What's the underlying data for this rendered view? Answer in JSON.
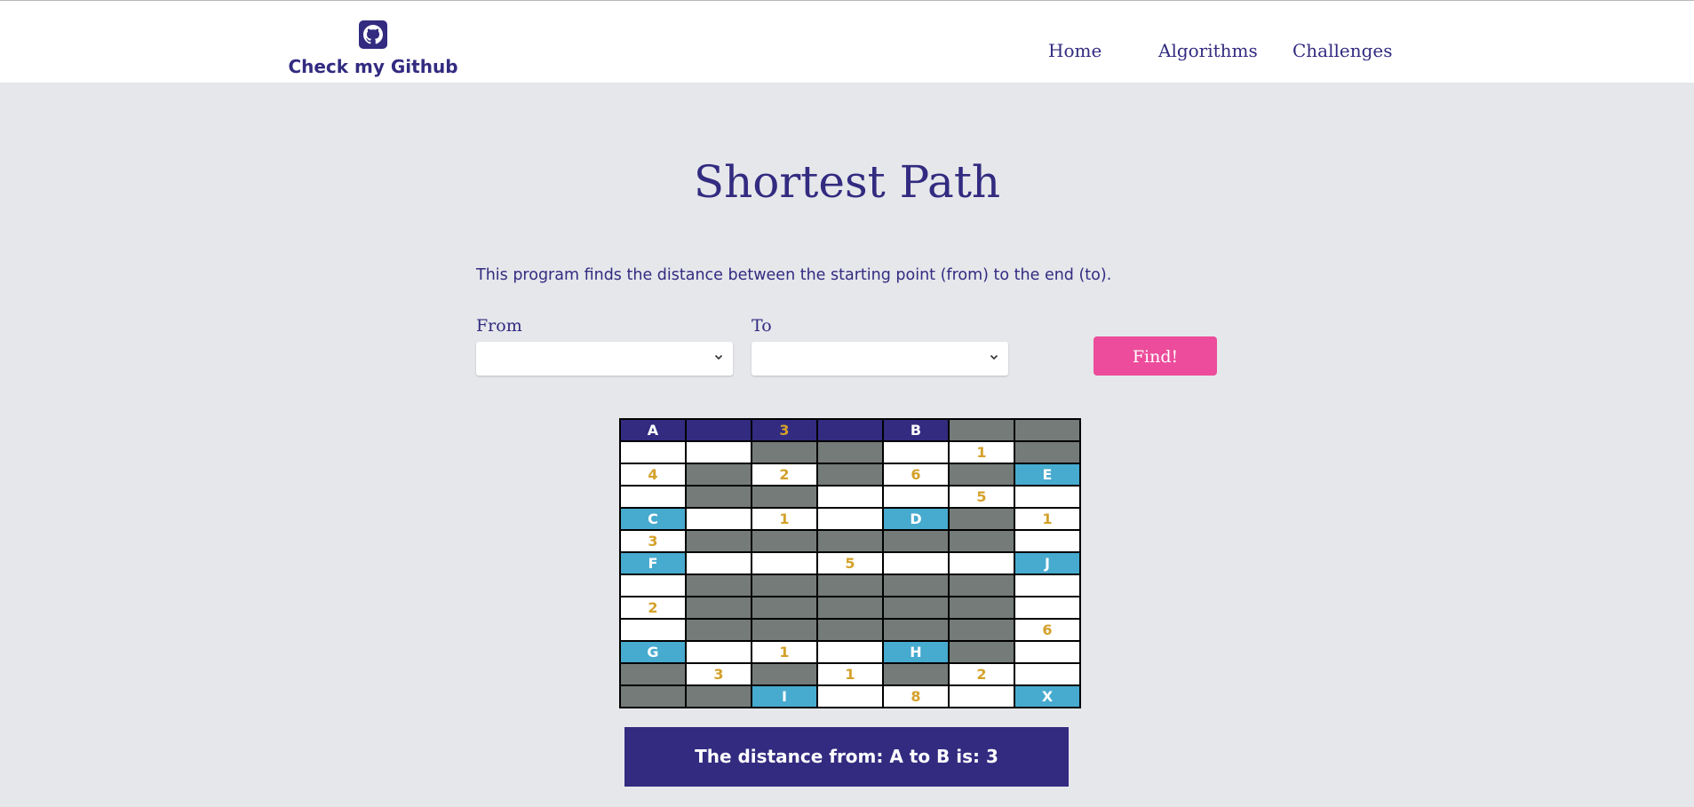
{
  "header": {
    "logo_text": "Check my Github",
    "nav": [
      "Home",
      "Algorithms",
      "Challenges"
    ]
  },
  "page": {
    "title": "Shortest Path",
    "description": "This program finds the distance between the starting point (from) to the end (to)."
  },
  "form": {
    "from_label": "From",
    "from_value": "",
    "to_label": "To",
    "to_value": "",
    "find_label": "Find!"
  },
  "grid": {
    "rows": [
      [
        [
          "s",
          "A"
        ],
        [
          "s",
          ""
        ],
        [
          "s",
          "3"
        ],
        [
          "s",
          ""
        ],
        [
          "s",
          "B"
        ],
        [
          "g",
          ""
        ],
        [
          "g",
          ""
        ]
      ],
      [
        [
          "w",
          ""
        ],
        [
          "w",
          ""
        ],
        [
          "g",
          ""
        ],
        [
          "g",
          ""
        ],
        [
          "w",
          ""
        ],
        [
          "w",
          "1"
        ],
        [
          "g",
          ""
        ]
      ],
      [
        [
          "w",
          "4"
        ],
        [
          "g",
          ""
        ],
        [
          "w",
          "2"
        ],
        [
          "g",
          ""
        ],
        [
          "w",
          "6"
        ],
        [
          "g",
          ""
        ],
        [
          "n",
          "E"
        ]
      ],
      [
        [
          "w",
          ""
        ],
        [
          "g",
          ""
        ],
        [
          "g",
          ""
        ],
        [
          "w",
          ""
        ],
        [
          "w",
          ""
        ],
        [
          "w",
          "5"
        ],
        [
          "w",
          ""
        ]
      ],
      [
        [
          "n",
          "C"
        ],
        [
          "w",
          ""
        ],
        [
          "w",
          "1"
        ],
        [
          "w",
          ""
        ],
        [
          "n",
          "D"
        ],
        [
          "g",
          ""
        ],
        [
          "w",
          "1"
        ]
      ],
      [
        [
          "w",
          "3"
        ],
        [
          "g",
          ""
        ],
        [
          "g",
          ""
        ],
        [
          "g",
          ""
        ],
        [
          "g",
          ""
        ],
        [
          "g",
          ""
        ],
        [
          "w",
          ""
        ]
      ],
      [
        [
          "n",
          "F"
        ],
        [
          "w",
          ""
        ],
        [
          "w",
          ""
        ],
        [
          "w",
          "5"
        ],
        [
          "w",
          ""
        ],
        [
          "w",
          ""
        ],
        [
          "n",
          "J"
        ]
      ],
      [
        [
          "w",
          ""
        ],
        [
          "g",
          ""
        ],
        [
          "g",
          ""
        ],
        [
          "g",
          ""
        ],
        [
          "g",
          ""
        ],
        [
          "g",
          ""
        ],
        [
          "w",
          ""
        ]
      ],
      [
        [
          "w",
          "2"
        ],
        [
          "g",
          ""
        ],
        [
          "g",
          ""
        ],
        [
          "g",
          ""
        ],
        [
          "g",
          ""
        ],
        [
          "g",
          ""
        ],
        [
          "w",
          ""
        ]
      ],
      [
        [
          "w",
          ""
        ],
        [
          "g",
          ""
        ],
        [
          "g",
          ""
        ],
        [
          "g",
          ""
        ],
        [
          "g",
          ""
        ],
        [
          "g",
          ""
        ],
        [
          "w",
          "6"
        ]
      ],
      [
        [
          "n",
          "G"
        ],
        [
          "w",
          ""
        ],
        [
          "w",
          "1"
        ],
        [
          "w",
          ""
        ],
        [
          "n",
          "H"
        ],
        [
          "g",
          ""
        ],
        [
          "w",
          ""
        ]
      ],
      [
        [
          "g",
          ""
        ],
        [
          "w",
          "3"
        ],
        [
          "g",
          ""
        ],
        [
          "w",
          "1"
        ],
        [
          "g",
          ""
        ],
        [
          "w",
          "2"
        ],
        [
          "w",
          ""
        ]
      ],
      [
        [
          "g",
          ""
        ],
        [
          "g",
          ""
        ],
        [
          "n",
          "I"
        ],
        [
          "w",
          ""
        ],
        [
          "w",
          "8"
        ],
        [
          "w",
          ""
        ],
        [
          "n",
          "X"
        ]
      ]
    ]
  },
  "result": {
    "text": "The distance from: A to B is: 3"
  },
  "colors": {
    "primary": "#322b80",
    "accent": "#ec4c9b",
    "node": "#47aacf",
    "wall": "#747b79",
    "weight": "#d4a12a",
    "background": "#e6e7eb"
  },
  "icons": {
    "logo": "github-icon",
    "select": "chevron-down-icon"
  }
}
